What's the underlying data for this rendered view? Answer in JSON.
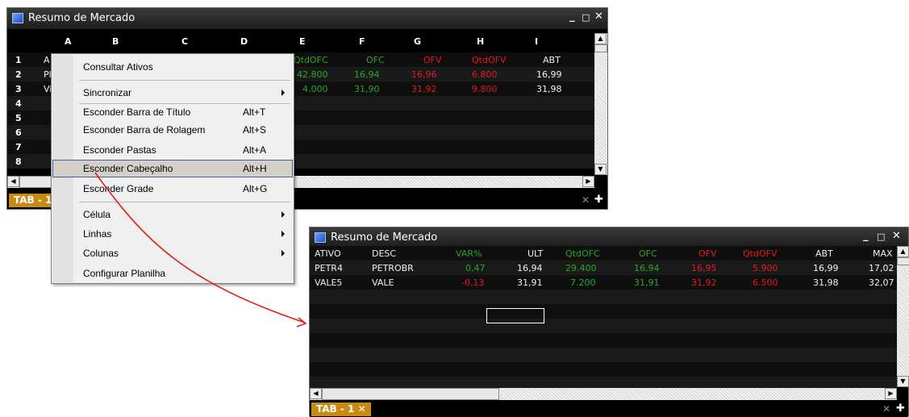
{
  "win1": {
    "title": "Resumo de Mercado",
    "min": "_",
    "max": "□",
    "close": "✕",
    "columns": [
      "A",
      "B",
      "C",
      "D",
      "E",
      "F",
      "G",
      "H",
      "I"
    ],
    "rownums": [
      "1",
      "2",
      "3",
      "4",
      "5",
      "6",
      "7",
      "8"
    ],
    "row_prefix": [
      "A",
      "Pl",
      "Vi"
    ],
    "header_cells": [
      "QtdOFC",
      "OFC",
      "OFV",
      "QtdOFV",
      "ABT"
    ],
    "data": [
      [
        "42.800",
        "16,94",
        "16,96",
        "6.800",
        "16,99"
      ],
      [
        "4.000",
        "31,90",
        "31,92",
        "9.800",
        "31,98"
      ]
    ],
    "tab": "TAB - 1",
    "tab_close": "✕",
    "tab_add": "✚",
    "colors": {
      "bg": "#000000",
      "green": "#27a827",
      "red": "#e31b1b",
      "tab": "#c88a10"
    }
  },
  "menu": {
    "items": [
      {
        "label": "Consultar Ativos",
        "shortcut": "",
        "submenu": false
      },
      {
        "label": "Sincronizar",
        "shortcut": "",
        "submenu": true
      },
      {
        "label": "Esconder Barra de Título",
        "shortcut": "Alt+T",
        "submenu": false
      },
      {
        "label": "Esconder Barra de Rolagem",
        "shortcut": "Alt+S",
        "submenu": false
      },
      {
        "label": "Esconder Pastas",
        "shortcut": "Alt+A",
        "submenu": false
      },
      {
        "label": "Esconder Cabeçalho",
        "shortcut": "Alt+H",
        "submenu": false,
        "highlighted": true
      },
      {
        "label": "Esconder Grade",
        "shortcut": "Alt+G",
        "submenu": false
      },
      {
        "label": "Célula",
        "shortcut": "",
        "submenu": true
      },
      {
        "label": "Linhas",
        "shortcut": "",
        "submenu": true
      },
      {
        "label": "Colunas",
        "shortcut": "",
        "submenu": true
      },
      {
        "label": "Configurar Planilha",
        "shortcut": "",
        "submenu": false
      }
    ]
  },
  "win2": {
    "title": "Resumo de Mercado",
    "min": "_",
    "max": "□",
    "close": "✕",
    "headers": [
      "ATIVO",
      "DESC",
      "VAR%",
      "ULT",
      "QtdOFC",
      "OFC",
      "OFV",
      "QtdOFV",
      "ABT",
      "MAX"
    ],
    "rows": [
      [
        "PETR4",
        "PETROBR",
        "0,47",
        "16,94",
        "29.400",
        "16,94",
        "16,95",
        "5.900",
        "16,99",
        "17,02"
      ],
      [
        "VALE5",
        "VALE",
        "-0,13",
        "31,91",
        "7.200",
        "31,91",
        "31,92",
        "6.500",
        "31,98",
        "32,07"
      ]
    ],
    "tab": "TAB - 1",
    "tab_close": "✕",
    "tab_add": "✚",
    "colors": {
      "bg": "#000000",
      "green": "#27a827",
      "red": "#e31b1b",
      "tab": "#c88a10",
      "arrow": "#e31b1b"
    }
  }
}
